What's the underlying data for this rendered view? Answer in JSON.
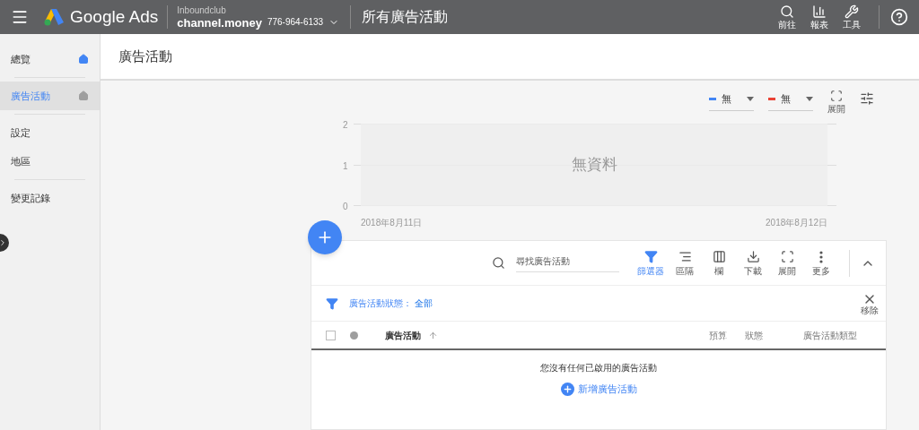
{
  "topbar": {
    "product": "Google Ads",
    "account_parent": "Inboundclub",
    "account_name": "channel.money",
    "account_id": "776-964-6133",
    "page_title": "所有廣告活動",
    "actions": [
      {
        "kind": "search",
        "label": "前往"
      },
      {
        "kind": "reports",
        "label": "報表"
      },
      {
        "kind": "tools",
        "label": "工具"
      }
    ]
  },
  "sidebar": {
    "items": [
      {
        "label": "總覽",
        "selected": false,
        "home_icon": {
          "active": true
        },
        "divider_after": true
      },
      {
        "label": "廣告活動",
        "selected": true,
        "home_icon": {
          "active": false
        },
        "divider_after": true
      },
      {
        "label": "設定",
        "selected": false,
        "divider_after": false
      },
      {
        "label": "地區",
        "selected": false,
        "divider_after": true
      },
      {
        "label": "變更記錄",
        "selected": false,
        "divider_after": false
      }
    ]
  },
  "header": {
    "title": "廣告活動"
  },
  "chart": {
    "metrics": [
      {
        "value": "無",
        "color": "#4285f4"
      },
      {
        "value": "無",
        "color": "#ea4335"
      }
    ],
    "expand_label": "展開",
    "yticks": [
      "2",
      "1",
      "0"
    ],
    "xlabels": [
      "2018年8月11日",
      "2018年8月12日"
    ],
    "empty_text": "無資料"
  },
  "table": {
    "search": {
      "placeholder": "尋找廣告活動"
    },
    "tools": [
      {
        "kind": "filter",
        "label": "篩選器",
        "selected": true
      },
      {
        "kind": "segment",
        "label": "區隔",
        "selected": false
      },
      {
        "kind": "columns",
        "label": "欄",
        "selected": false
      },
      {
        "kind": "download",
        "label": "下載",
        "selected": false
      },
      {
        "kind": "expand",
        "label": "展開",
        "selected": false
      },
      {
        "kind": "more",
        "label": "更多",
        "selected": false
      }
    ],
    "filter": {
      "label": "廣告活動狀態：",
      "value": "全部",
      "remove_label": "移除"
    },
    "select_all": {
      "checked": false
    },
    "columns": [
      {
        "label": "廣告活動",
        "sorted": true
      },
      {
        "label": "預算",
        "sorted": false
      },
      {
        "label": "狀態",
        "sorted": false
      },
      {
        "label": "廣告活動類型",
        "sorted": false
      }
    ],
    "empty_message": "您沒有任何已啟用的廣告活動",
    "add_label": "新增廣告活動"
  }
}
